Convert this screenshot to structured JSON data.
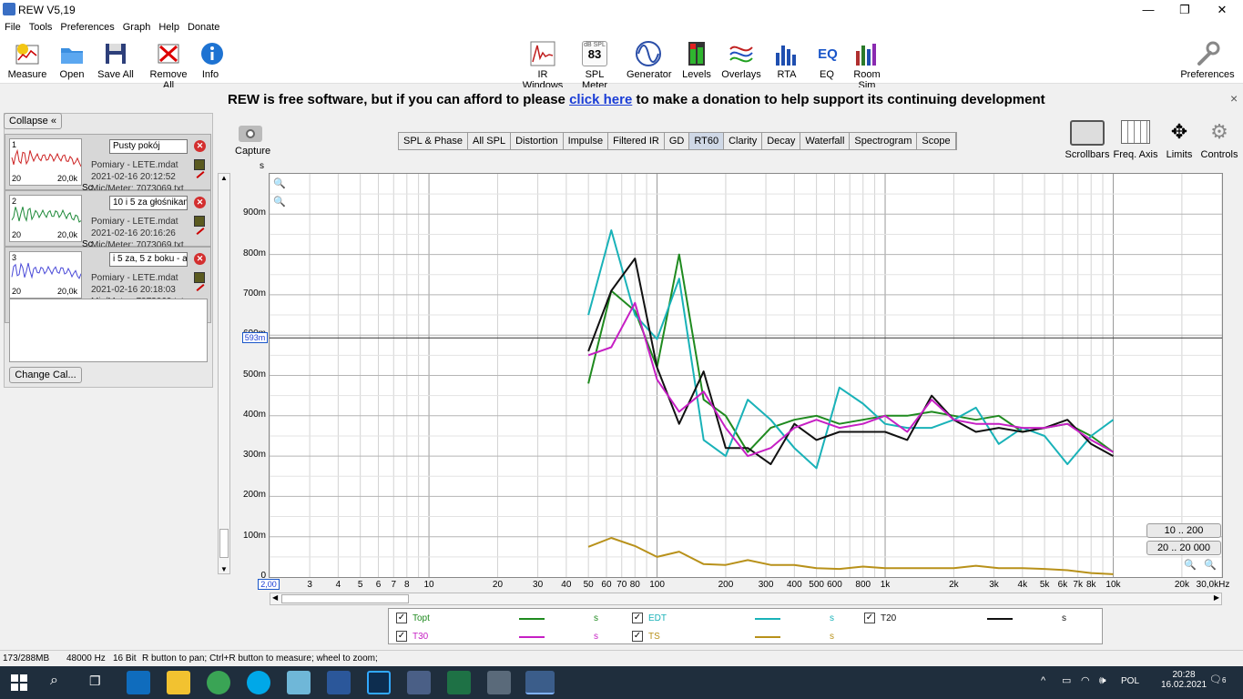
{
  "window": {
    "title": "REW V5,19",
    "minimize": "—",
    "maximize": "❐",
    "close": "✕"
  },
  "menu": [
    "File",
    "Tools",
    "Preferences",
    "Graph",
    "Help",
    "Donate"
  ],
  "toolbar": {
    "left": [
      "Measure",
      "Open",
      "Save All",
      "Remove All",
      "Info"
    ],
    "center": [
      "IR Windows",
      "SPL Meter",
      "Generator",
      "Levels",
      "Overlays",
      "RTA",
      "EQ",
      "Room Sim"
    ],
    "spl_icon_top": "dB SPL",
    "spl_icon_value": "83",
    "eq_icon": "EQ",
    "right": "Preferences"
  },
  "banner": {
    "before": "REW is free software, but if you can afford to please",
    "link": "click here",
    "after": "to make a donation to help support its continuing development",
    "close": "×"
  },
  "panel": {
    "collapse": "Collapse",
    "change_cal": "Change Cal...",
    "measurements": [
      {
        "num": "1",
        "name": "Pusty pokój",
        "file": "Pomiary - LETE.mdat",
        "date": "2021-02-16 20:12:52",
        "mic": "Mic/Meter: 7073069.txt",
        "extra": "Sc",
        "t0": "20",
        "t1": "20,0k",
        "color": "#cc2222"
      },
      {
        "num": "2",
        "name": "10 i 5 za głośnikami",
        "file": "Pomiary - LETE.mdat",
        "date": "2021-02-16 20:16:26",
        "mic": "Mic/Meter: 7073069.txt",
        "extra": "Sc",
        "t0": "20",
        "t1": "20,0k",
        "color": "#1f8a3a"
      },
      {
        "num": "3",
        "name": "i 5 za, 5 z boku - all",
        "file": "Pomiary - LETE.mdat",
        "date": "2021-02-16 20:18:03",
        "mic": "Mic/Meter: 7073069.txt",
        "extra": "Soundcard: No Cal",
        "t0": "20",
        "t1": "20,0k",
        "color": "#4a4ad8"
      }
    ]
  },
  "capture": {
    "label": "Capture",
    "unit": "s"
  },
  "tabs": [
    "SPL & Phase",
    "All SPL",
    "Distortion",
    "Impulse",
    "Filtered IR",
    "GD",
    "RT60",
    "Clarity",
    "Decay",
    "Waterfall",
    "Spectrogram",
    "Scope"
  ],
  "active_tab": "RT60",
  "graph_tools": [
    "Scrollbars",
    "Freq. Axis",
    "Limits",
    "Controls"
  ],
  "range_buttons": [
    "10 .. 200",
    "20 .. 20 000"
  ],
  "cursor": {
    "value_label": "593m",
    "freq_label": "2,00"
  },
  "chart_data": {
    "type": "line",
    "xscale": "log",
    "xlim": [
      2,
      30000
    ],
    "ylim": [
      0,
      1.0
    ],
    "ylabel": "s",
    "yticks": [
      {
        "v": 0,
        "l": "0"
      },
      {
        "v": 0.1,
        "l": "100m"
      },
      {
        "v": 0.2,
        "l": "200m"
      },
      {
        "v": 0.3,
        "l": "300m"
      },
      {
        "v": 0.4,
        "l": "400m"
      },
      {
        "v": 0.5,
        "l": "500m"
      },
      {
        "v": 0.6,
        "l": "600m"
      },
      {
        "v": 0.7,
        "l": "700m"
      },
      {
        "v": 0.8,
        "l": "800m"
      },
      {
        "v": 0.9,
        "l": "900m"
      }
    ],
    "xticks": [
      {
        "v": 3,
        "l": "3"
      },
      {
        "v": 4,
        "l": "4"
      },
      {
        "v": 5,
        "l": "5"
      },
      {
        "v": 6,
        "l": "6"
      },
      {
        "v": 7,
        "l": "7"
      },
      {
        "v": 8,
        "l": "8"
      },
      {
        "v": 10,
        "l": "10"
      },
      {
        "v": 20,
        "l": "20"
      },
      {
        "v": 30,
        "l": "30"
      },
      {
        "v": 40,
        "l": "40"
      },
      {
        "v": 50,
        "l": "50"
      },
      {
        "v": 60,
        "l": "60"
      },
      {
        "v": 70,
        "l": "70"
      },
      {
        "v": 80,
        "l": "80"
      },
      {
        "v": 100,
        "l": "100"
      },
      {
        "v": 200,
        "l": "200"
      },
      {
        "v": 300,
        "l": "300"
      },
      {
        "v": 400,
        "l": "400"
      },
      {
        "v": 500,
        "l": "500"
      },
      {
        "v": 600,
        "l": "600"
      },
      {
        "v": 800,
        "l": "800"
      },
      {
        "v": 1000,
        "l": "1k"
      },
      {
        "v": 2000,
        "l": "2k"
      },
      {
        "v": 3000,
        "l": "3k"
      },
      {
        "v": 4000,
        "l": "4k"
      },
      {
        "v": 5000,
        "l": "5k"
      },
      {
        "v": 6000,
        "l": "6k"
      },
      {
        "v": 7000,
        "l": "7k"
      },
      {
        "v": 8000,
        "l": "8k"
      },
      {
        "v": 10000,
        "l": "10k"
      },
      {
        "v": 20000,
        "l": "20k"
      },
      {
        "v": 30000,
        "l": "30,0kHz"
      }
    ],
    "cursor_y": 0.593,
    "x": [
      50,
      63,
      80,
      100,
      125,
      160,
      200,
      250,
      315,
      400,
      500,
      630,
      800,
      1000,
      1250,
      1600,
      2000,
      2500,
      3150,
      4000,
      5000,
      6300,
      8000,
      10000
    ],
    "series": [
      {
        "name": "Topt",
        "color": "#1f8a1f",
        "values": [
          0.48,
          0.71,
          0.66,
          0.52,
          0.8,
          0.44,
          0.4,
          0.31,
          0.37,
          0.39,
          0.4,
          0.38,
          0.39,
          0.4,
          0.4,
          0.41,
          0.4,
          0.39,
          0.4,
          0.36,
          0.37,
          0.38,
          0.35,
          0.31
        ]
      },
      {
        "name": "EDT",
        "color": "#19b2b8",
        "values": [
          0.65,
          0.86,
          0.65,
          0.59,
          0.74,
          0.34,
          0.3,
          0.44,
          0.39,
          0.32,
          0.27,
          0.47,
          0.43,
          0.38,
          0.37,
          0.37,
          0.39,
          0.42,
          0.33,
          0.37,
          0.35,
          0.28,
          0.35,
          0.39
        ]
      },
      {
        "name": "T20",
        "color": "#111111",
        "values": [
          0.56,
          0.71,
          0.79,
          0.52,
          0.38,
          0.51,
          0.32,
          0.32,
          0.28,
          0.38,
          0.34,
          0.36,
          0.36,
          0.36,
          0.34,
          0.45,
          0.39,
          0.36,
          0.37,
          0.36,
          0.37,
          0.39,
          0.33,
          0.3
        ]
      },
      {
        "name": "T30",
        "color": "#c61fc4",
        "values": [
          0.55,
          0.57,
          0.68,
          0.49,
          0.41,
          0.46,
          0.37,
          0.3,
          0.32,
          0.37,
          0.39,
          0.37,
          0.38,
          0.4,
          0.36,
          0.44,
          0.39,
          0.38,
          0.38,
          0.37,
          0.37,
          0.38,
          0.34,
          0.31
        ]
      },
      {
        "name": "TS",
        "color": "#b8911a",
        "values": [
          0.075,
          0.097,
          0.077,
          0.05,
          0.063,
          0.032,
          0.03,
          0.042,
          0.03,
          0.03,
          0.022,
          0.02,
          0.026,
          0.022,
          0.022,
          0.022,
          0.022,
          0.028,
          0.022,
          0.022,
          0.02,
          0.017,
          0.01,
          0.007
        ]
      }
    ]
  },
  "legend": [
    {
      "name": "Topt",
      "color": "#1f8a1f",
      "unit": "s",
      "checked": "✓"
    },
    {
      "name": "EDT",
      "color": "#19b2b8",
      "unit": "s",
      "checked": "✓"
    },
    {
      "name": "T20",
      "color": "#111111",
      "unit": "s",
      "checked": "✓"
    },
    {
      "name": "T30",
      "color": "#c61fc4",
      "unit": "s",
      "checked": "✓"
    },
    {
      "name": "TS",
      "color": "#b8911a",
      "unit": "s",
      "checked": "✓"
    }
  ],
  "status": {
    "memory": "173/288MB",
    "rate": "48000 Hz",
    "bits": "16 Bit",
    "hint": "R button to pan; Ctrl+R button to measure; wheel to zoom;"
  },
  "taskbar": {
    "time": "20:28",
    "date": "16.02.2021",
    "lang": "POL",
    "notif": "6"
  }
}
